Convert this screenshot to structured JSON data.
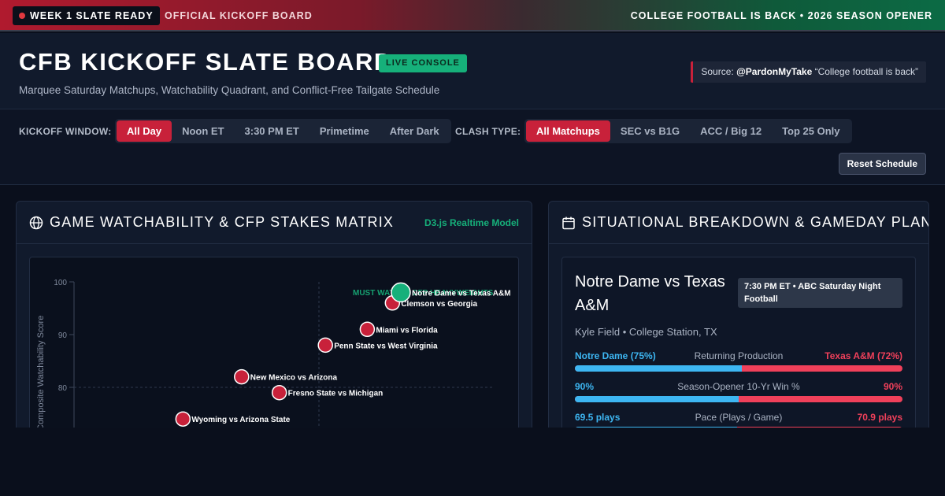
{
  "topbar": {
    "badge": "WEEK 1 SLATE READY",
    "official": "OFFICIAL KICKOFF BOARD",
    "tagline": "COLLEGE FOOTBALL IS BACK • 2026 SEASON OPENER"
  },
  "header": {
    "title": "CFB KICKOFF SLATE BOARD",
    "live_badge": "LIVE CONSOLE",
    "subtitle": "Marquee Saturday Matchups, Watchability Quadrant, and Conflict-Free Tailgate Schedule",
    "source_prefix": "Source:",
    "source_handle": "@PardonMyTake",
    "source_quote": "“College football is back”"
  },
  "filters": {
    "kickoff_label": "KICKOFF WINDOW:",
    "kickoff_options": [
      "All Day",
      "Noon ET",
      "3:30 PM ET",
      "Primetime",
      "After Dark"
    ],
    "kickoff_selected": "All Day",
    "clash_label": "CLASH TYPE:",
    "clash_options": [
      "All Matchups",
      "SEC vs B1G",
      "ACC / Big 12",
      "Top 25 Only"
    ],
    "clash_selected": "All Matchups",
    "reset_label": "Reset Schedule"
  },
  "matrix_panel": {
    "title": "GAME WATCHABILITY & CFP STAKES MATRIX",
    "icon": "globe-icon",
    "model_tag": "D3.js Realtime Model"
  },
  "chart_data": {
    "type": "scatter",
    "ylabel": "Composite Watchability Score",
    "y_ticks": [
      100,
      90,
      80
    ],
    "ylim": [
      72,
      100
    ],
    "quadrant_label": "MUST WATCH / CFP HEAVYWEIGHTS",
    "quadrant_split_y": 80,
    "colors": {
      "point": "#c8213a",
      "highlight": "#16b07a"
    },
    "points": [
      {
        "label": "Notre Dame vs Texas A&M",
        "x": 0.78,
        "y": 98.0,
        "highlight": true
      },
      {
        "label": "Clemson vs Georgia",
        "x": 0.76,
        "y": 96.0,
        "highlight": false
      },
      {
        "label": "Miami vs Florida",
        "x": 0.7,
        "y": 91.0,
        "highlight": false
      },
      {
        "label": "Penn State vs West Virginia",
        "x": 0.6,
        "y": 88.0,
        "highlight": false
      },
      {
        "label": "New Mexico vs Arizona",
        "x": 0.4,
        "y": 82.0,
        "highlight": false
      },
      {
        "label": "Fresno State vs Michigan",
        "x": 0.49,
        "y": 79.0,
        "highlight": false
      },
      {
        "label": "Wyoming vs Arizona State",
        "x": 0.26,
        "y": 74.0,
        "highlight": false
      }
    ]
  },
  "breakdown_panel": {
    "title": "SITUATIONAL BREAKDOWN & GAMEDAY PLAN",
    "icon": "calendar-icon",
    "match": "Notre Dame vs Texas A&M",
    "time": "7:30 PM ET • ABC Saturday Night Football",
    "venue": "Kyle Field • College Station, TX",
    "stats": [
      {
        "left": "Notre Dame (75%)",
        "label": "Returning Production",
        "right": "Texas A&M (72%)",
        "share": 0.51
      },
      {
        "left": "90%",
        "label": "Season-Opener 10-Yr Win %",
        "right": "90%",
        "share": 0.5
      },
      {
        "left": "69.5 plays",
        "label": "Pace (Plays / Game)",
        "right": "70.9 plays",
        "share": 0.495
      }
    ]
  }
}
